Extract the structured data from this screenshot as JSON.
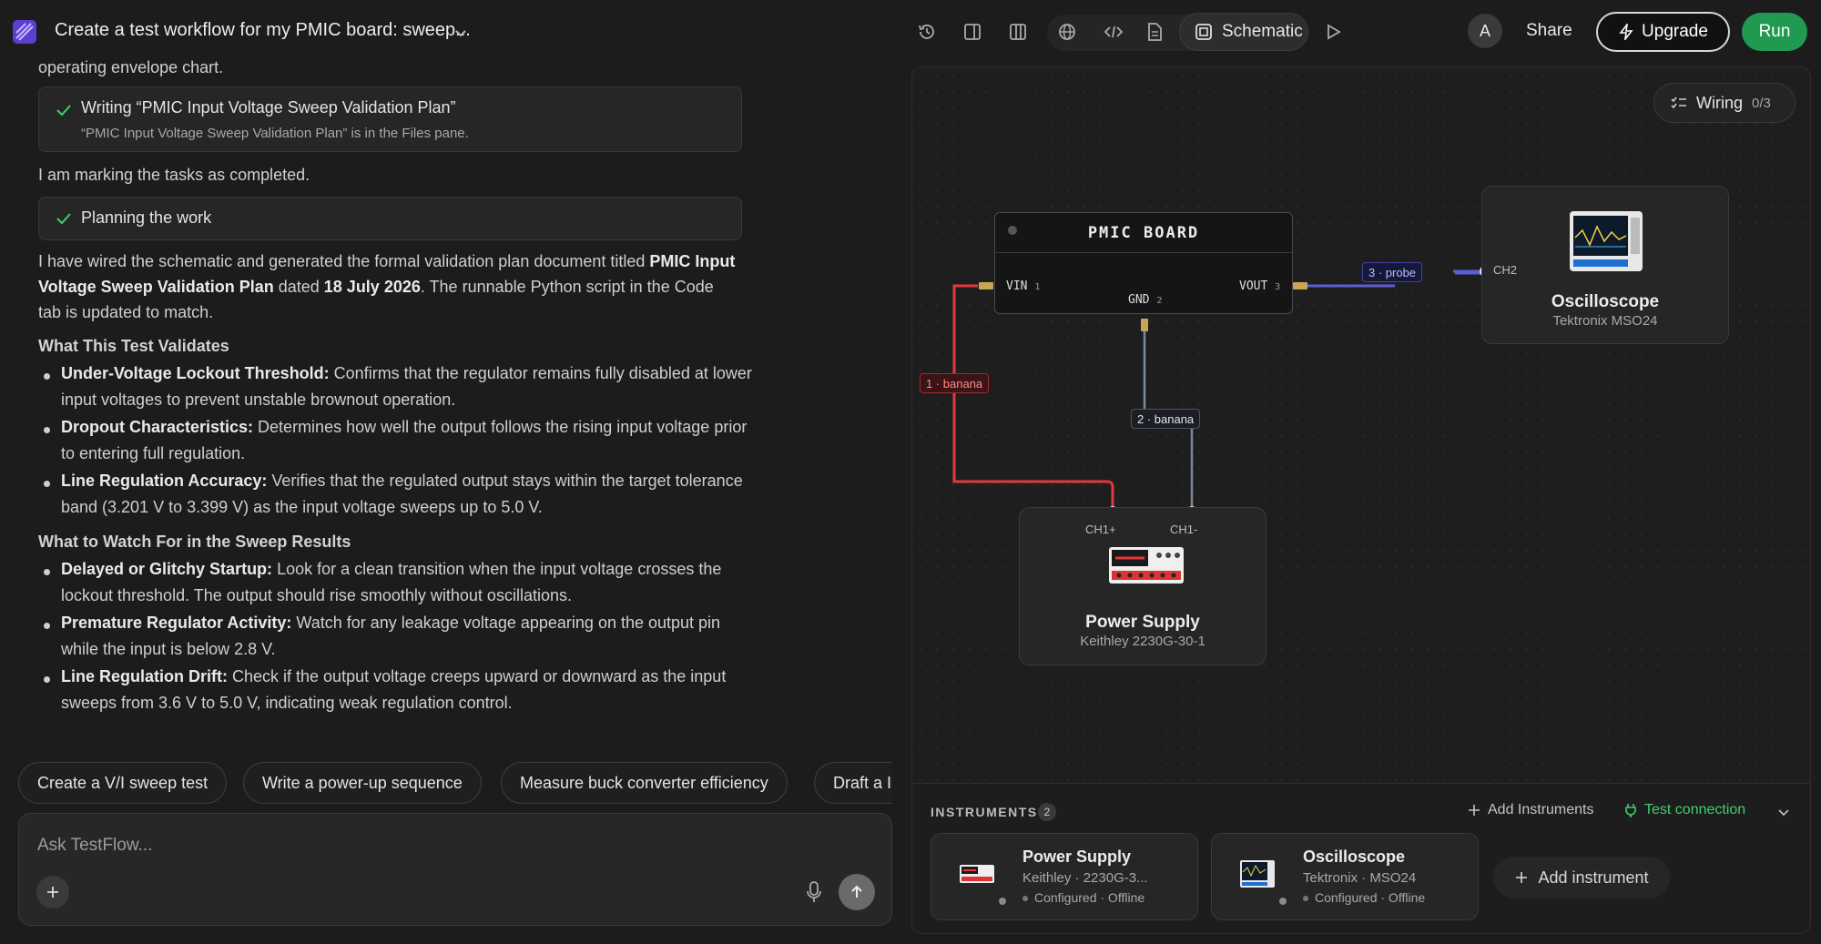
{
  "header": {
    "chat_title": "Create a test workflow for my PMIC board: sweep...",
    "schematic_label": "Schematic",
    "avatar_initial": "A",
    "share_label": "Share",
    "upgrade_label": "Upgrade",
    "run_label": "Run"
  },
  "chat": {
    "truncated_top": "operating envelope chart.",
    "task1": {
      "title": "Writing “PMIC Input Voltage Sweep Validation Plan”",
      "subtitle": "“PMIC Input Voltage Sweep Validation Plan” is in the Files pane."
    },
    "marking": "I am marking the tasks as completed.",
    "task2": {
      "title": "Planning the work"
    },
    "summary": {
      "part1": "I have wired the schematic and generated the formal validation plan document titled ",
      "doc_title": "PMIC Input Voltage Sweep Validation Plan",
      "part2": " dated ",
      "date": "18 July 2026",
      "part3": ". The runnable Python script in the Code tab is updated to match."
    },
    "section1_heading": "What This Test Validates",
    "section1_items": [
      {
        "title": "Under-Voltage Lockout Threshold:",
        "text": " Confirms that the regulator remains fully disabled at lower input voltages to prevent unstable brownout operation."
      },
      {
        "title": "Dropout Characteristics:",
        "text": " Determines how well the output follows the rising input voltage prior to entering full regulation."
      },
      {
        "title": "Line Regulation Accuracy:",
        "text": " Verifies that the regulated output stays within the target tolerance band (3.201 V to 3.399 V) as the input voltage sweeps up to 5.0 V."
      }
    ],
    "section2_heading": "What to Watch For in the Sweep Results",
    "section2_items": [
      {
        "title": "Delayed or Glitchy Startup:",
        "text": " Look for a clean transition when the input voltage crosses the lockout threshold. The output should rise smoothly without oscillations."
      },
      {
        "title": "Premature Regulator Activity:",
        "text": " Watch for any leakage voltage appearing on the output pin while the input is below 2.8 V."
      },
      {
        "title": "Line Regulation Drift:",
        "text": " Check if the output voltage creeps upward or downward as the input sweeps from 3.6 V to 5.0 V, indicating weak regulation control."
      }
    ],
    "suggestions": [
      "Create a V/I sweep test",
      "Write a power-up sequence",
      "Measure buck converter efficiency",
      "Draft a I"
    ],
    "composer_placeholder": "Ask TestFlow..."
  },
  "schematic": {
    "wiring_label": "Wiring",
    "wiring_count": "0/3",
    "pmic": {
      "title": "PMIC BOARD",
      "pins": [
        {
          "name": "VIN",
          "num": "1"
        },
        {
          "name": "GND",
          "num": "2"
        },
        {
          "name": "VOUT",
          "num": "3"
        }
      ]
    },
    "oscilloscope": {
      "name": "Oscilloscope",
      "model": "Tektronix MSO24",
      "port": "CH2"
    },
    "power_supply": {
      "name": "Power Supply",
      "model": "Keithley 2230G-30-1",
      "port_pos": "CH1+",
      "port_neg": "CH1-"
    },
    "wires": [
      {
        "label": "1 · banana",
        "color": "#e0393e"
      },
      {
        "label": "2 · banana",
        "color": "#7d8a99"
      },
      {
        "label": "3 · probe",
        "color": "#5b5fd6"
      }
    ]
  },
  "instruments_tray": {
    "title": "INSTRUMENTS",
    "count": "2",
    "add_link": "Add Instruments",
    "test_connection": "Test connection",
    "cards": [
      {
        "name": "Power Supply",
        "model": "Keithley · 2230G-3...",
        "status": "Configured · Offline"
      },
      {
        "name": "Oscilloscope",
        "model": "Tektronix · MSO24",
        "status": "Configured · Offline"
      }
    ],
    "add_button": "Add instrument"
  }
}
